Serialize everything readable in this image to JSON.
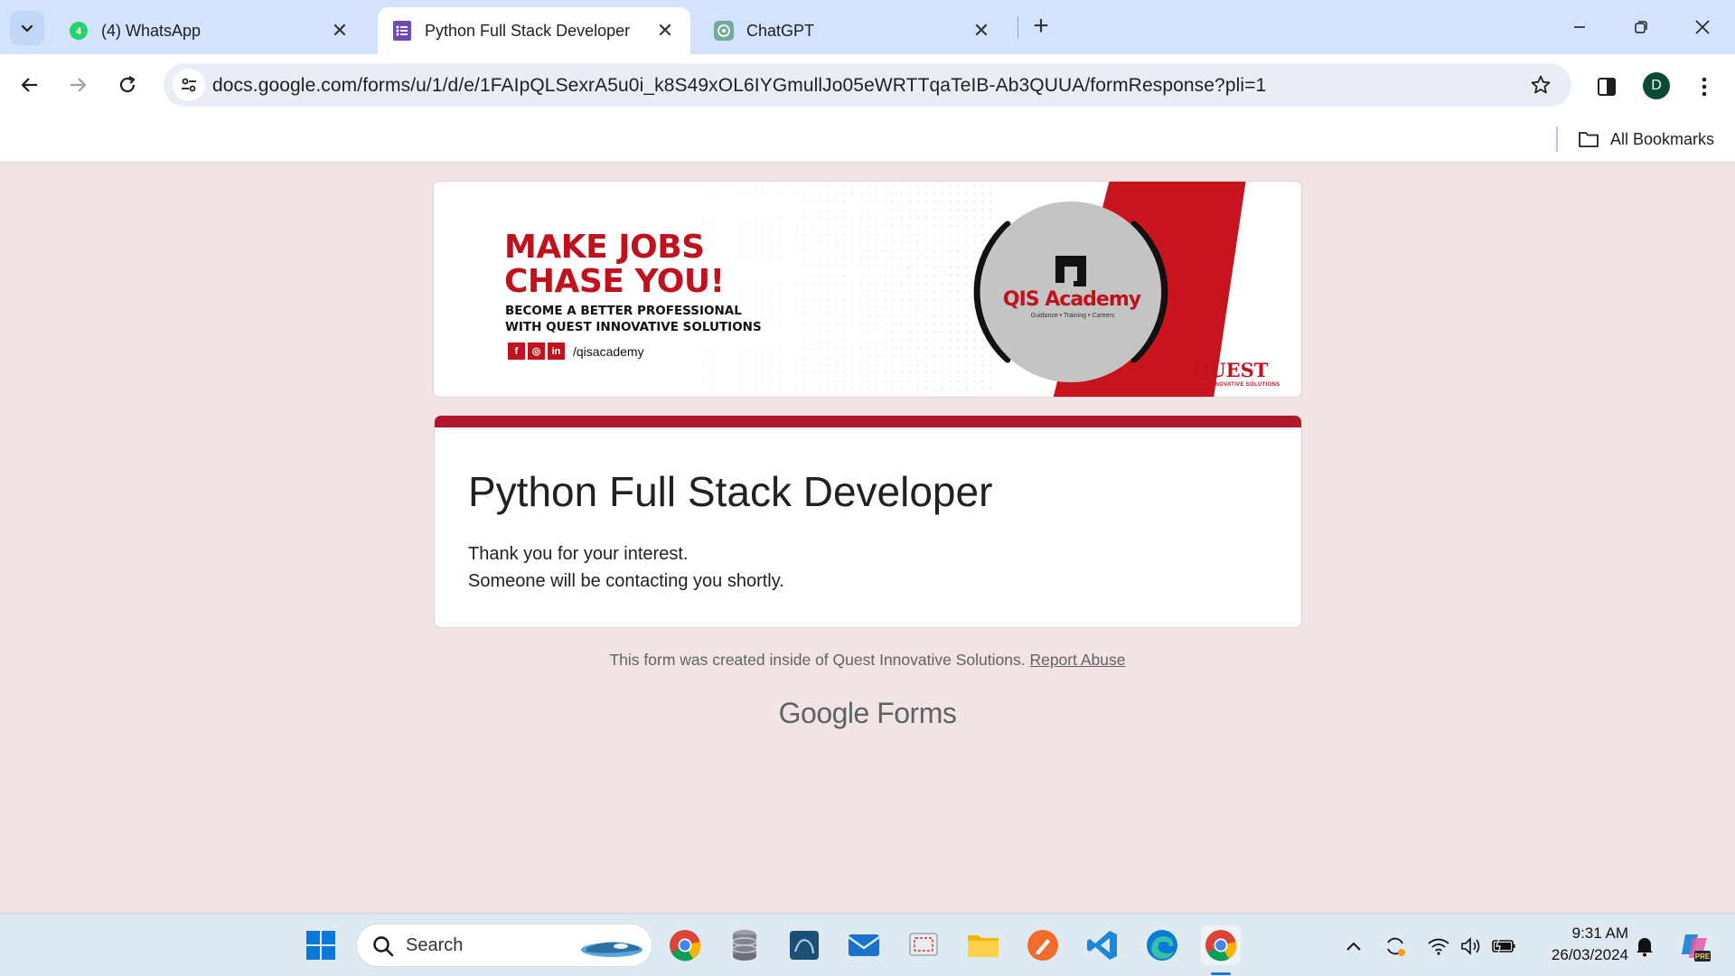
{
  "browser": {
    "tabs": [
      {
        "title": "(4) WhatsApp",
        "icon": "whatsapp-icon",
        "active": false
      },
      {
        "title": "Python Full Stack Developer",
        "icon": "google-forms-icon",
        "active": true
      },
      {
        "title": "ChatGPT",
        "icon": "chatgpt-icon",
        "active": false
      }
    ],
    "url": "docs.google.com/forms/u/1/d/e/1FAIpQLSexrA5u0i_k8S49xOL6IYGmullJo05eWRTTqaTeIB-Ab3QUUA/formResponse?pli=1",
    "profile_initial": "D",
    "bookmarks_label": "All Bookmarks"
  },
  "banner": {
    "headline_1": "MAKE JOBS",
    "headline_2": "CHASE YOU!",
    "sub_1": "BECOME A BETTER PROFESSIONAL",
    "sub_2": "WITH QUEST INNOVATIVE SOLUTIONS",
    "social_handle": "/qisacademy",
    "logo_text": "QIS Academy",
    "logo_tagline": "Guidance • Training • Careers",
    "brand": "QUEST",
    "brand_sub": "INNOVATIVE SOLUTIONS",
    "colors": {
      "brand_red": "#c0121e"
    }
  },
  "form": {
    "title": "Python Full Stack Developer",
    "message_1": "Thank you for your interest.",
    "message_2": "Someone will be contacting you shortly.",
    "accent_color": "#b0172b"
  },
  "footer": {
    "note": "This form was created inside of Quest Innovative Solutions.",
    "report_link": "Report Abuse",
    "logo_google": "Google",
    "logo_forms": "Forms"
  },
  "taskbar": {
    "search_label": "Search",
    "time": "9:31 AM",
    "date": "26/03/2024"
  }
}
